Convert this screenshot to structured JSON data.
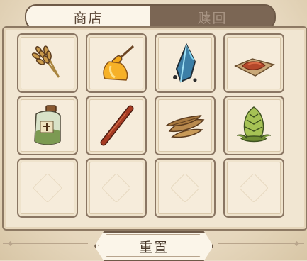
{
  "tabs": [
    {
      "label": "商店",
      "active": true
    },
    {
      "label": "赎回",
      "active": false
    }
  ],
  "slots": [
    {
      "item": "wheat-icon"
    },
    {
      "item": "honey-icon"
    },
    {
      "item": "crystal-icon"
    },
    {
      "item": "red-powder-icon"
    },
    {
      "item": "herb-jar-icon"
    },
    {
      "item": "cinnamon-stick-icon"
    },
    {
      "item": "dried-pods-icon"
    },
    {
      "item": "artichoke-icon"
    },
    {
      "item": ""
    },
    {
      "item": ""
    },
    {
      "item": ""
    },
    {
      "item": ""
    }
  ],
  "reset_label": "重置"
}
